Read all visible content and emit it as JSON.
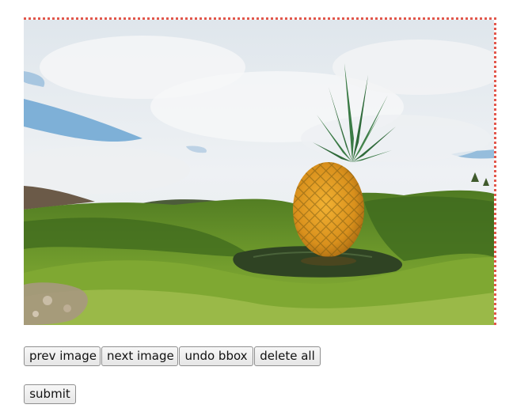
{
  "toolbar": {
    "prev_label": "prev image",
    "next_label": "next image",
    "undo_label": "undo bbox",
    "delete_label": "delete all"
  },
  "form": {
    "submit_label": "submit"
  },
  "annotation": {
    "outline_color": "#e2574c"
  }
}
